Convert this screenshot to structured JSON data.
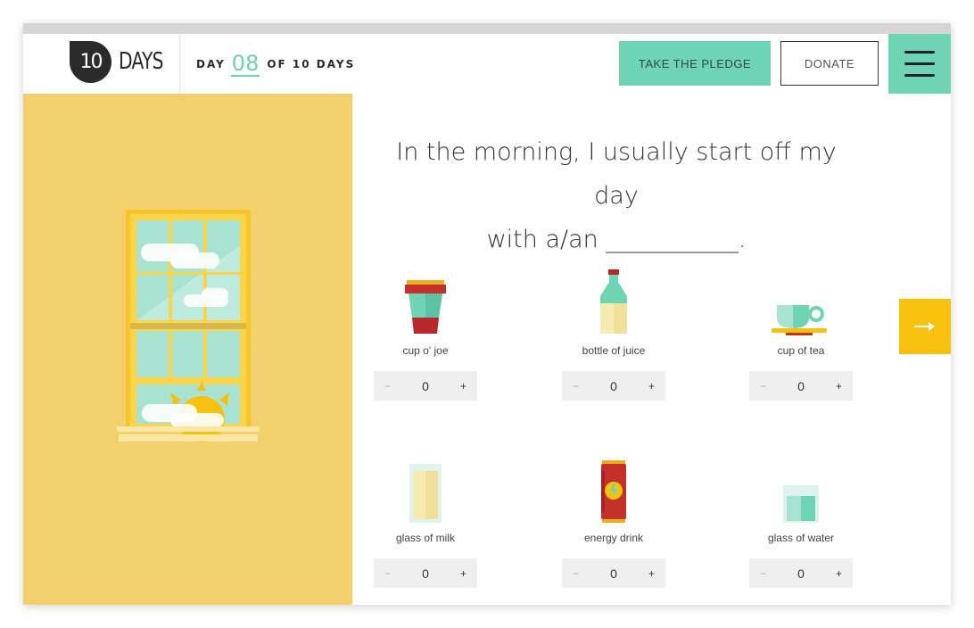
{
  "header": {
    "logo_number": "10",
    "logo_word": "DAYS",
    "day_prefix": "DAY",
    "day_current": "08",
    "day_suffix": "OF 10 DAYS",
    "pledge_label": "TAKE THE PLEDGE",
    "donate_label": "DONATE"
  },
  "question": {
    "line1": "In the morning, I usually start off my day",
    "line2": "with a/an ___________."
  },
  "items": [
    {
      "label": "cup o' joe",
      "value": "0",
      "icon": "coffee-cup-icon"
    },
    {
      "label": "bottle of juice",
      "value": "0",
      "icon": "juice-bottle-icon"
    },
    {
      "label": "cup of tea",
      "value": "0",
      "icon": "tea-cup-icon"
    },
    {
      "label": "glass of milk",
      "value": "0",
      "icon": "milk-glass-icon"
    },
    {
      "label": "energy drink",
      "value": "0",
      "icon": "energy-drink-icon"
    },
    {
      "label": "glass of water",
      "value": "0",
      "icon": "water-glass-icon"
    }
  ],
  "stepper": {
    "minus": "−",
    "plus": "+"
  },
  "colors": {
    "accent": "#6fd4b4",
    "panel": "#f2d16c",
    "next": "#f6c20e",
    "text": "#333333"
  }
}
